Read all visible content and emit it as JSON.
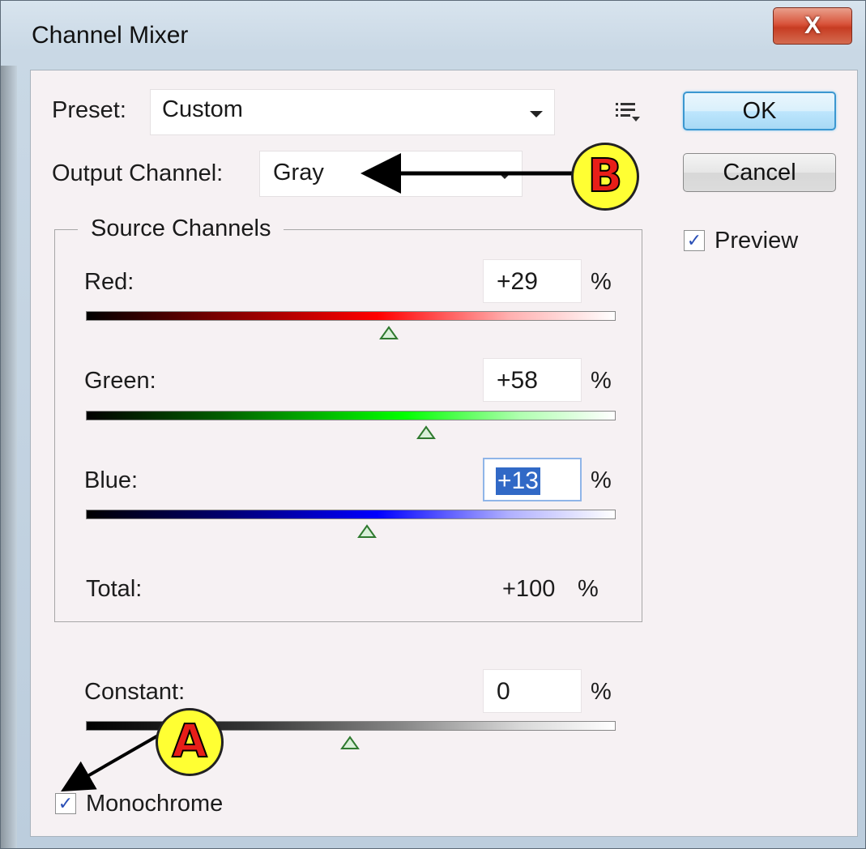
{
  "window": {
    "title": "Channel Mixer",
    "close_label": "X"
  },
  "preset": {
    "label": "Preset:",
    "value": "Custom"
  },
  "output_channel": {
    "label": "Output Channel:",
    "value": "Gray"
  },
  "buttons": {
    "ok": "OK",
    "cancel": "Cancel"
  },
  "preview": {
    "label": "Preview",
    "checked": true
  },
  "source_channels": {
    "legend": "Source Channels",
    "channels": [
      {
        "label": "Red:",
        "value": "+29",
        "unit": "%",
        "level": 0.29,
        "color": "#ff0000"
      },
      {
        "label": "Green:",
        "value": "+58",
        "unit": "%",
        "level": 0.58,
        "color": "#00ff00"
      },
      {
        "label": "Blue:",
        "value": "+13",
        "unit": "%",
        "level": 0.13,
        "color": "#0000ff"
      }
    ],
    "total": {
      "label": "Total:",
      "value": "+100",
      "unit": "%"
    }
  },
  "constant": {
    "label": "Constant:",
    "value": "0",
    "unit": "%",
    "level": 0.0
  },
  "monochrome": {
    "label": "Monochrome",
    "checked": true
  },
  "annotations": {
    "a": "A",
    "b": "B"
  },
  "check_mark": "✓"
}
